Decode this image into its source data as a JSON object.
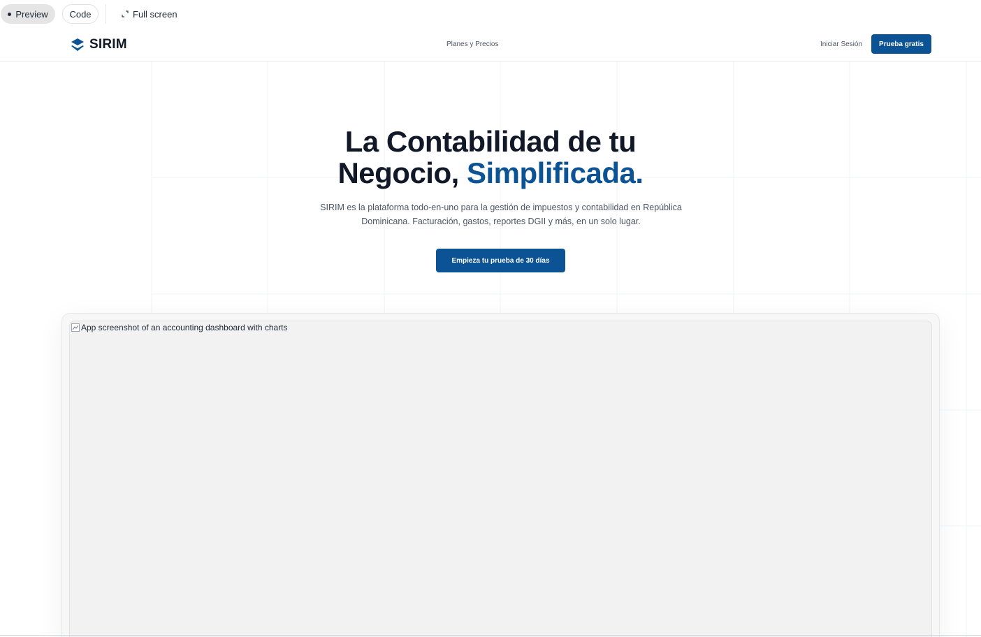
{
  "toolbar": {
    "preview_label": "Preview",
    "code_label": "Code",
    "fullscreen_label": "Full screen"
  },
  "nav": {
    "brand": "SIRIM",
    "pricing_link": "Planes y Precios",
    "login_link": "Iniciar Sesión",
    "cta_label": "Prueba gratis"
  },
  "hero": {
    "title_part1": "La Contabilidad de tu",
    "title_part2": "Negocio,",
    "title_accent": "Simplificada.",
    "subtitle": "SIRIM es la plataforma todo-en-uno para la gestión de impuestos y contabilidad en República Dominicana. Facturación, gastos, reportes DGII y más, en un solo lugar.",
    "cta_label": "Empieza tu prueba de 30 días"
  },
  "preview_image": {
    "alt_text": "App screenshot of an accounting dashboard with charts"
  },
  "colors": {
    "brand": "#0b5394",
    "heading": "#111827",
    "body_text": "#4b5563"
  },
  "icons": {
    "logo": "layered-diamond-logo-icon",
    "fullscreen": "expand-icon",
    "broken_image": "broken-image-icon"
  }
}
